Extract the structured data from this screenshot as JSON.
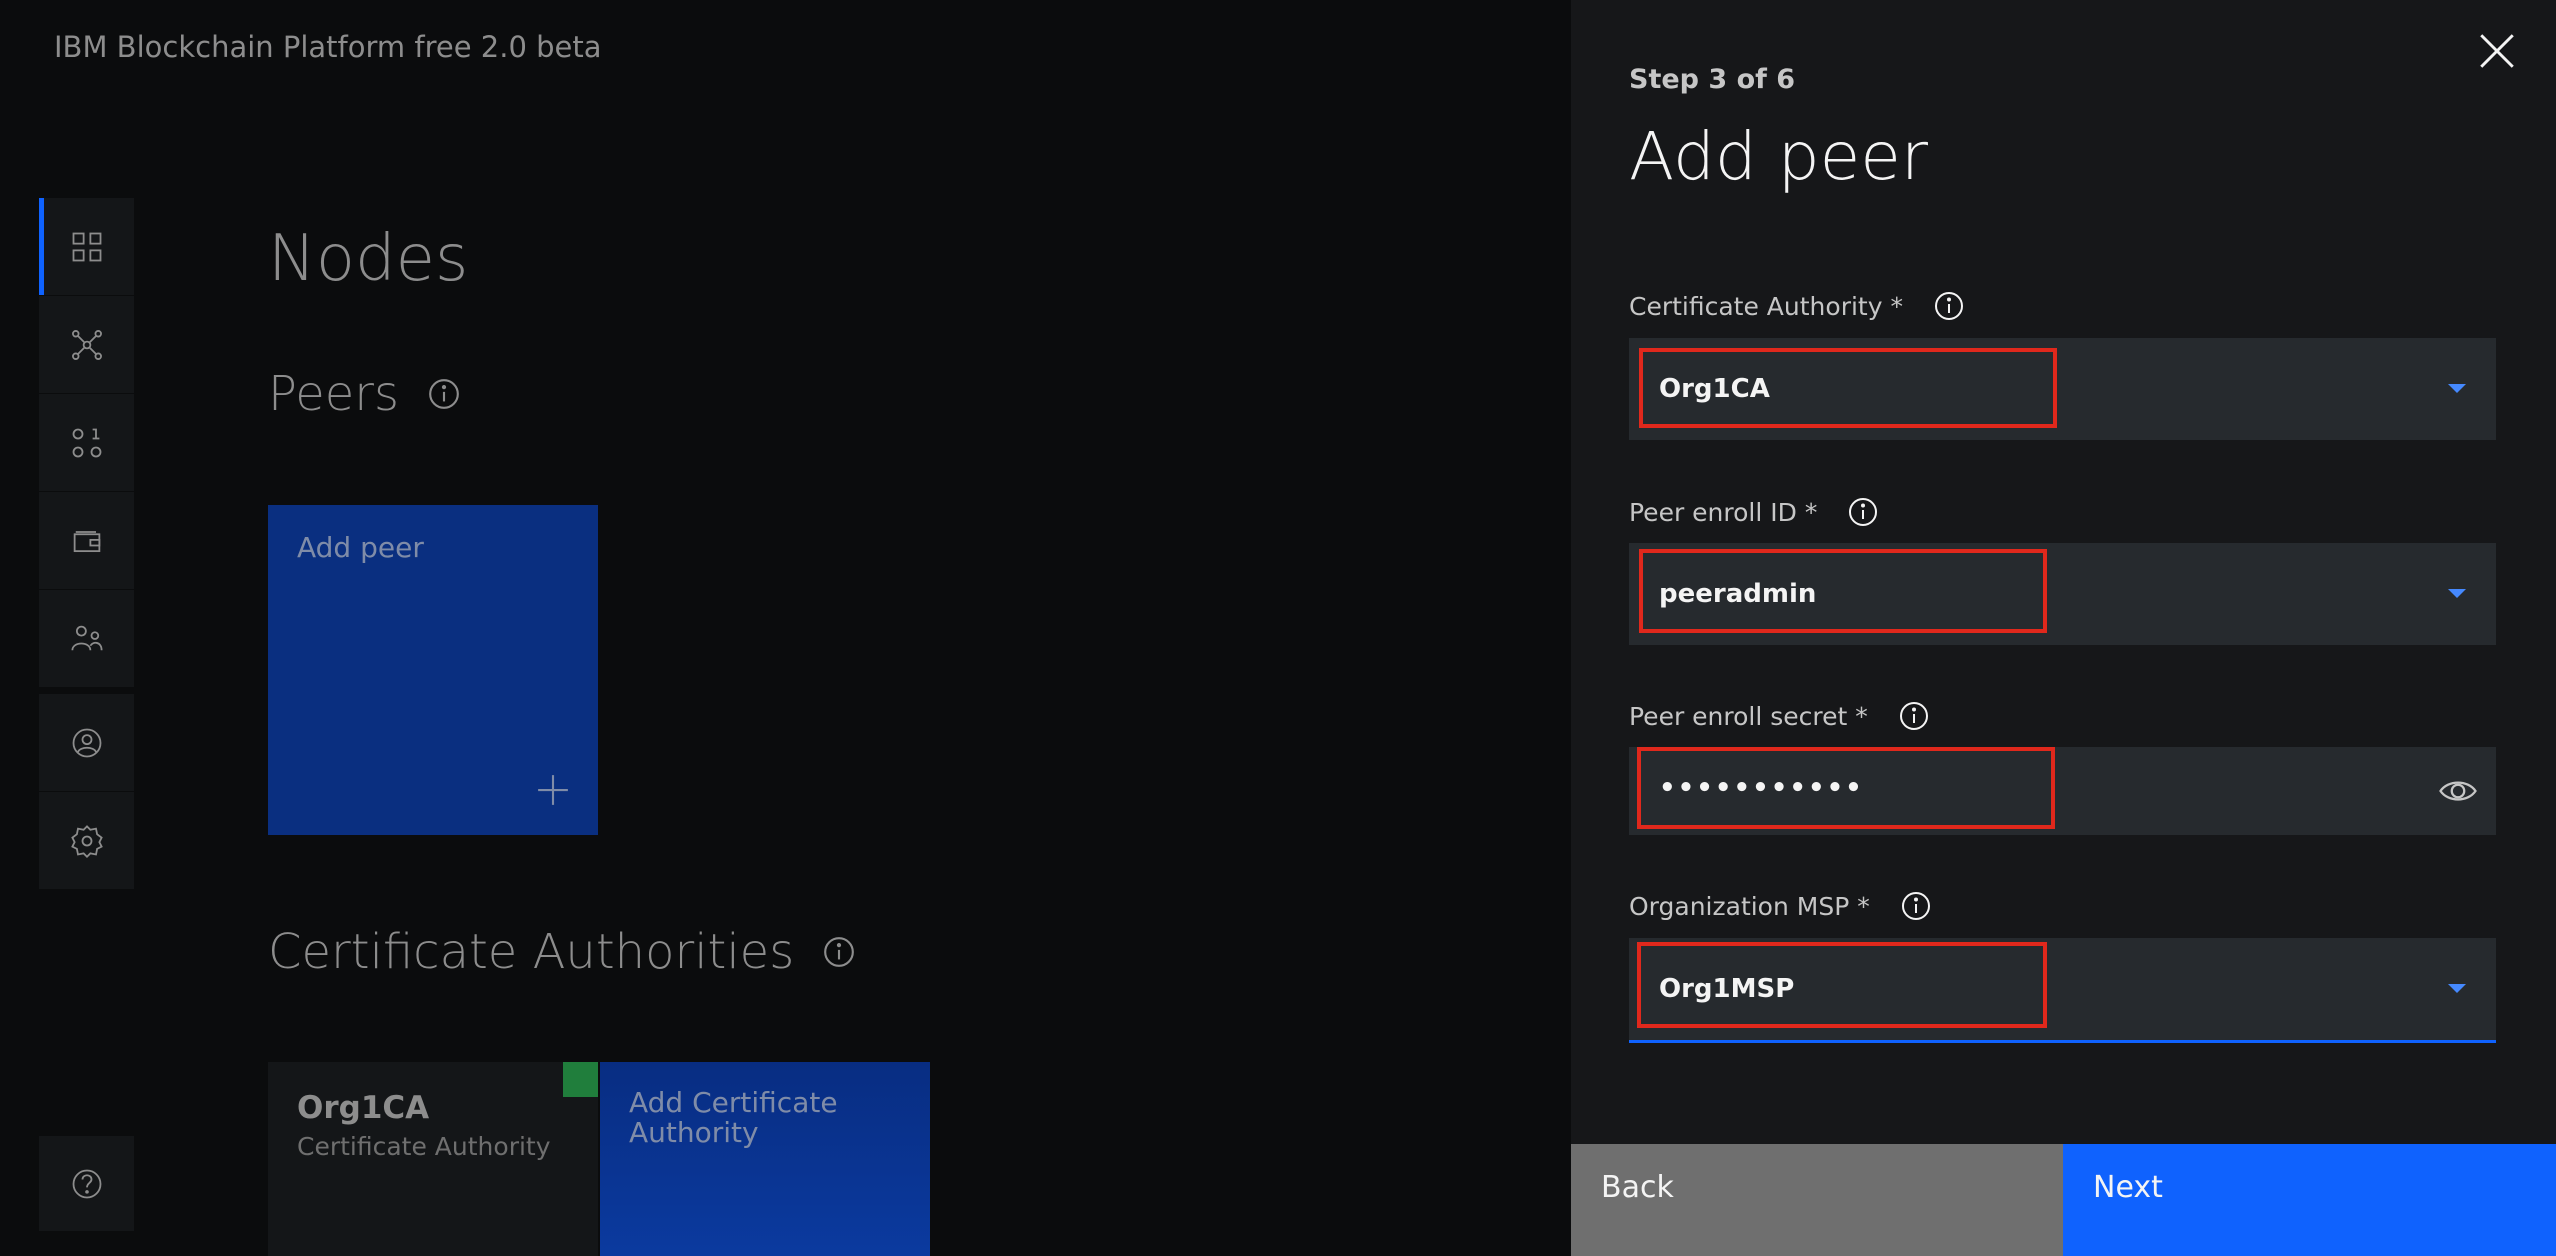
{
  "app": {
    "title": "IBM Blockchain Platform free 2.0 beta"
  },
  "sidebar": {
    "items": [
      {
        "icon": "dashboard-grid-icon",
        "active": true
      },
      {
        "icon": "network-icon"
      },
      {
        "icon": "binary-code-icon"
      },
      {
        "icon": "wallet-icon"
      },
      {
        "icon": "users-icon"
      }
    ],
    "secondary": [
      {
        "icon": "user-profile-icon"
      },
      {
        "icon": "settings-gear-icon"
      }
    ],
    "help": {
      "icon": "help-icon"
    }
  },
  "main": {
    "title": "Nodes",
    "peers": {
      "title": "Peers",
      "add_tile_label": "Add peer"
    },
    "cas": {
      "title": "Certificate Authorities",
      "items": [
        {
          "name": "Org1CA",
          "type": "Certificate Authority",
          "status_color": "#24a148"
        }
      ],
      "add_tile_label": "Add Certificate Authority"
    }
  },
  "panel": {
    "step": "Step 3 of 6",
    "title": "Add peer",
    "fields": {
      "ca": {
        "label": "Certificate Authority *",
        "value": "Org1CA"
      },
      "enroll_id": {
        "label": "Peer enroll ID *",
        "value": "peeradmin"
      },
      "enroll_secret": {
        "label": "Peer enroll secret *",
        "value": "•••••••••••"
      },
      "msp": {
        "label": "Organization MSP *",
        "value": "Org1MSP"
      }
    },
    "back_label": "Back",
    "next_label": "Next"
  },
  "colors": {
    "accent": "#0f62fe",
    "highlight": "#e0281c",
    "tile_blue": "#0a2f80",
    "panel_bg": "#161719"
  }
}
